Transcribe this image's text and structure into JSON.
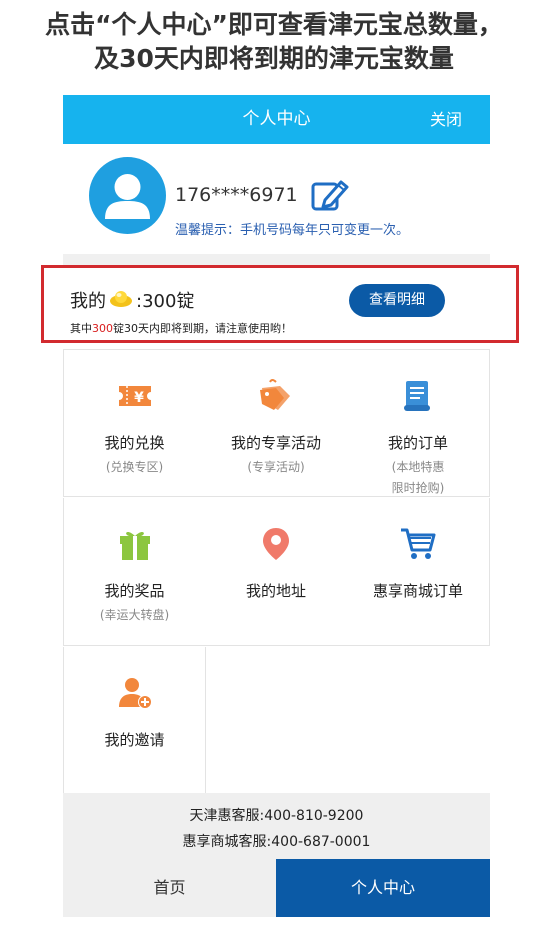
{
  "caption": {
    "line1": "点击“个人中心”即可查看津元宝总数量，",
    "line2": "及30天内即将到期的津元宝数量"
  },
  "header": {
    "title": "个人中心",
    "close_label": "关闭",
    "color": "#16b3ee"
  },
  "profile": {
    "phone": "176****6971",
    "tip": "温馨提示：手机号码每年只可变更一次。",
    "avatar_icon": "user-avatar-icon",
    "edit_icon": "edit-pencil-icon"
  },
  "ingots": {
    "label_prefix": "我的",
    "amount_text": ":300锭",
    "note_prefix": "其中",
    "note_amount": "300",
    "note_suffix": "锭30天内即将到期，请注意使用哟！",
    "detail_button": "查看明细"
  },
  "menu": [
    {
      "label": "我的兑换",
      "sub": "(兑换专区)",
      "icon": "ticket-yen-icon"
    },
    {
      "label": "我的专享活动",
      "sub": "(专享活动)",
      "icon": "tag-icon"
    },
    {
      "label": "我的订单",
      "sub": "(本地特惠\n限时抢购)",
      "icon": "receipt-scroll-icon"
    },
    {
      "label": "我的奖品",
      "sub": "(幸运大转盘)",
      "icon": "gift-icon"
    },
    {
      "label": "我的地址",
      "sub": "",
      "icon": "location-pin-icon"
    },
    {
      "label": "惠享商城订单",
      "sub": "",
      "icon": "shopping-cart-icon"
    },
    {
      "label": "我的邀请",
      "sub": "",
      "icon": "add-user-icon"
    }
  ],
  "footer": {
    "service1": "天津惠客服:400-810-9200",
    "service2": "惠享商城客服:400-687-0001"
  },
  "tabs": {
    "home": "首页",
    "me": "个人中心"
  },
  "colors": {
    "accent_blue": "#0b5aa6",
    "highlight_red": "#d22a2f",
    "orange_icon": "#f2873c"
  }
}
